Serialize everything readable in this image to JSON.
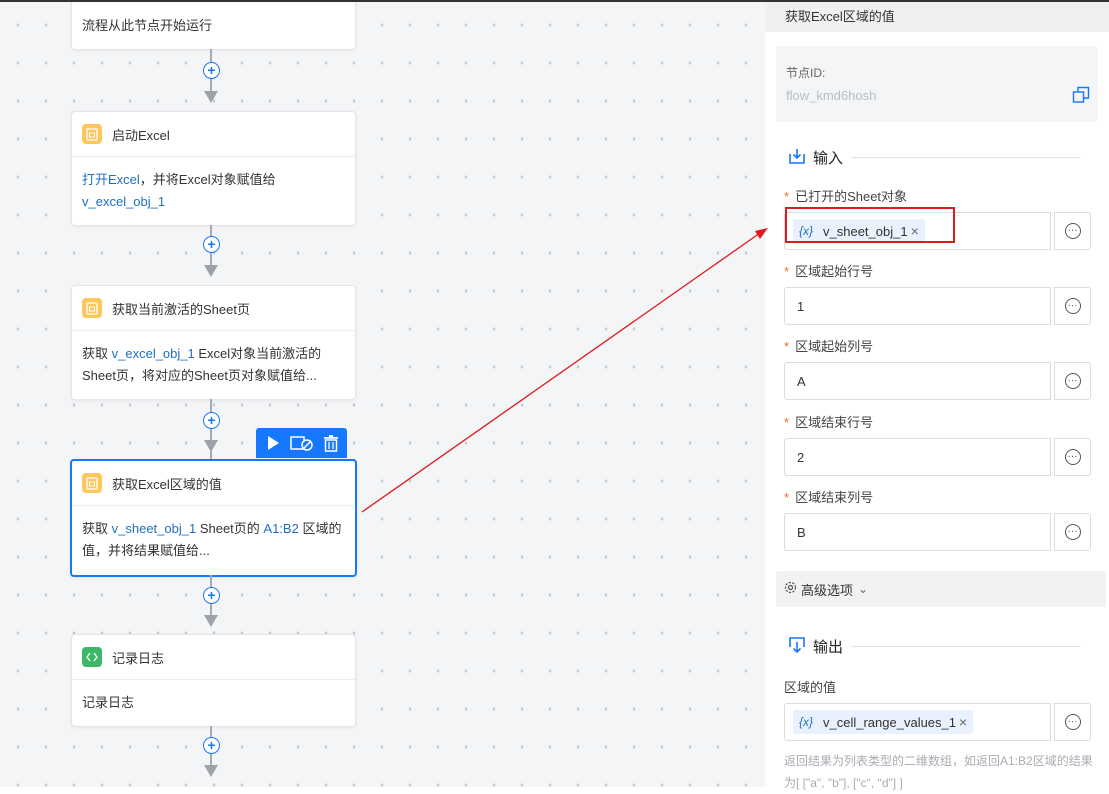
{
  "canvas": {
    "nodes": [
      {
        "title": "",
        "desc": "流程从此节点开始运行"
      },
      {
        "title": "启动Excel",
        "desc_parts": [
          "打开Excel",
          "，并将Excel对象赋值给",
          "v_excel_obj_1"
        ]
      },
      {
        "title": "获取当前激活的Sheet页",
        "desc_parts": [
          "获取 ",
          "v_excel_obj_1",
          " Excel对象当前激活的Sheet页，将对应的Sheet页对象赋值给..."
        ]
      },
      {
        "title": "获取Excel区域的值",
        "desc_parts": [
          "获取 ",
          "v_sheet_obj_1",
          " Sheet页的 ",
          "A1:B2",
          " 区域的值，并将结果赋值给..."
        ]
      },
      {
        "title": "记录日志",
        "desc": "记录日志"
      }
    ],
    "toolbar_icons": [
      "play-icon",
      "disable-icon",
      "trash-icon"
    ],
    "colors": {
      "accent": "#1677ff",
      "excel_icon": "#ffc65c",
      "log_icon": "#3db86b",
      "annotation_red": "#e0191c"
    }
  },
  "panel": {
    "title": "获取Excel区域的值",
    "node_id_label": "节点ID:",
    "node_id_value": "flow_kmd6hosh",
    "input_title": "输入",
    "fields": [
      {
        "label": "已打开的Sheet对象",
        "required": true,
        "tag": "v_sheet_obj_1",
        "tag_symbol": "{x}",
        "close": "×"
      },
      {
        "label": "区域起始行号",
        "required": true,
        "value": "1"
      },
      {
        "label": "区域起始列号",
        "required": true,
        "value": "A"
      },
      {
        "label": "区域结束行号",
        "required": true,
        "value": "2"
      },
      {
        "label": "区域结束列号",
        "required": true,
        "value": "B"
      }
    ],
    "required_mark": "*",
    "advanced_label": "高级选项",
    "advanced_chevron": "⌄",
    "output_title": "输出",
    "output_field": {
      "label": "区域的值",
      "tag": "v_cell_range_values_1",
      "tag_symbol": "{x}",
      "close": "×"
    },
    "output_desc": "返回结果为列表类型的二维数组，如返回A1:B2区域的结果为[ [\"a\", \"b\"], [\"c\", \"d\"] ]"
  }
}
